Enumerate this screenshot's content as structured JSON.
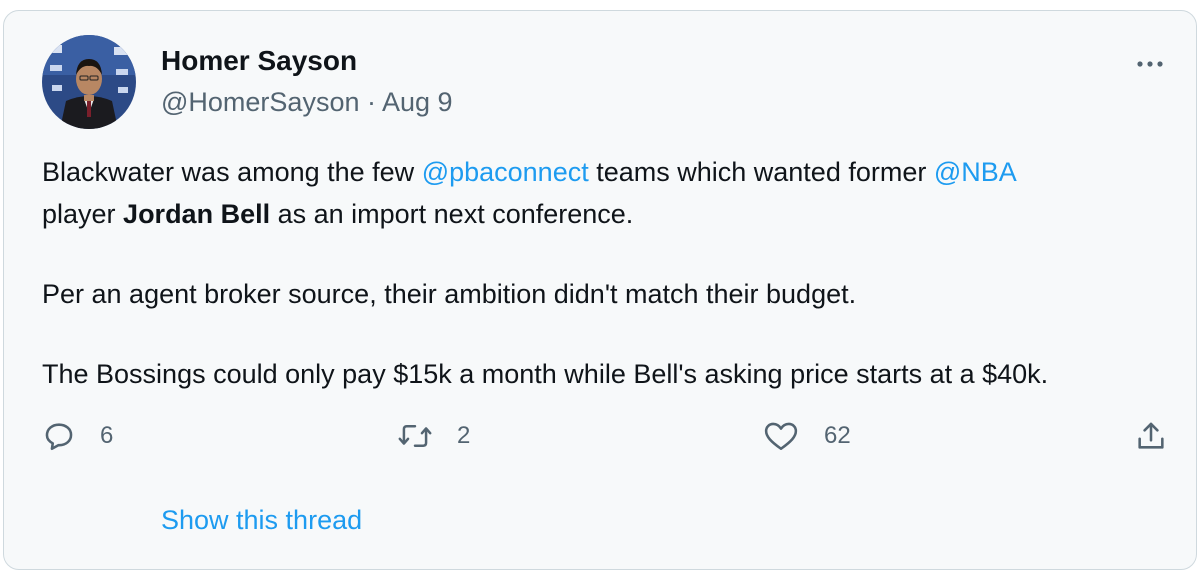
{
  "tweet": {
    "author_name": "Homer Sayson",
    "handle": "@HomerSayson",
    "separator": " · ",
    "date": "Aug 9",
    "text": {
      "p1_a": "Blackwater was among the few ",
      "p1_mention1": "@pbaconnect",
      "p1_b": " teams which wanted former ",
      "p1_mention2": "@NBA",
      "p1_c": " player ",
      "p1_bold": "Jordan Bell",
      "p1_d": " as an import next conference.",
      "p2": "Per an agent broker source, their ambition didn't match their budget.",
      "p3": "The Bossings could only pay $15k a month while Bell's asking price starts at a $40k."
    },
    "actions": {
      "reply_count": "6",
      "retweet_count": "2",
      "like_count": "62"
    },
    "show_thread_label": "Show this thread"
  },
  "icons": {
    "more": "more-dots-icon",
    "reply": "reply-bubble-icon",
    "retweet": "retweet-arrows-icon",
    "like": "heart-icon",
    "share": "share-upload-icon"
  },
  "colors": {
    "link": "#1d9bf0",
    "secondary_text": "#536471",
    "card_background": "#f7f9fa",
    "border": "#cfd9de"
  }
}
